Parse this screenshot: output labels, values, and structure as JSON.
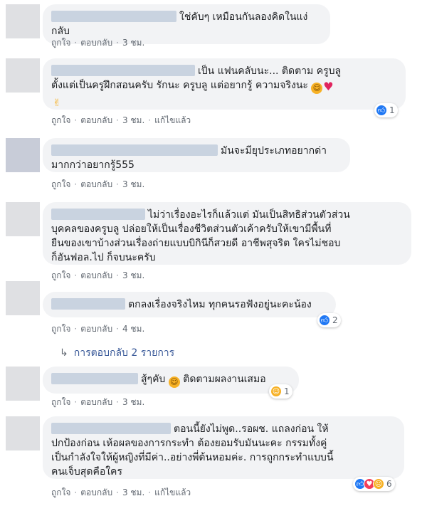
{
  "actions": {
    "like": "ถูกใจ",
    "reply": "ตอบกลับ",
    "edited": "แก้ไขแล้ว",
    "sep": "·"
  },
  "comments": [
    {
      "name": "",
      "text": "ใช่คับๆ เหมือนกันลองคิดในแง่กลับ",
      "time": "3 ชม."
    },
    {
      "name": "",
      "text1": "เป็น แฟนคลับนะ... ติดตาม ครูบลู",
      "text2": "ตั้งแต่เป็นครูฝึกสอนครับ รักนะ ครูบลู แต่อยากรู้ ความจริงนะ",
      "emoji": [
        "smile-emoji",
        "heart-emoji",
        "hand-emoji"
      ],
      "time": "3 ชม.",
      "edited": true,
      "reactions": {
        "count": "1",
        "icons": [
          "like"
        ]
      }
    },
    {
      "name": "",
      "text1": "มันจะมียุประเภทอยากด่า",
      "text2": "มากกว่าอยากรู้555",
      "time": "3 ชม."
    },
    {
      "name": "",
      "text1": "ไม่ว่าเรื่องอะไรก็แล้วแต่ มันเป็นสิทธิส่วนตัวส่วน",
      "text2": "บุคคลของครูบลู ปล่อยให้เป็นเรื่องชีวิตส่วนตัวเค้าครับให้เขามีพื้นที่",
      "text3": "ยืนของเขาบ้างส่วนเรื่องถ่ายแบบบิกินีก็สวยดี อาชีพสุจริต ใครไม่ชอบ",
      "text4": "ก็อันฟอล.ไป ก็จบนะครับ",
      "time": "3 ชม."
    },
    {
      "name": "",
      "text": "ตกลงเรื่องจริงไหม ทุกคนรอฟังอยู่นะคะน้อง",
      "time": "4 ชม.",
      "reactions": {
        "count": "2",
        "icons": [
          "like"
        ]
      }
    },
    {
      "name": "",
      "text": "สู้ๆคับ",
      "text_after": "ติดตามผลงานเสมอ",
      "time": "3 ชม.",
      "reactions": {
        "count": "1",
        "icons": [
          "haha"
        ]
      }
    },
    {
      "name": "",
      "text1": "ตอนนี้ยังไม่พูด..รอผช. แถลงก่อน ให้",
      "text2": "ปกป้องก่อน เห้อผลของการกระทำ ต้องยอมรับมันนะคะ กรรมทั้งคู่",
      "text3": "เป็นกำลังใจให้ผู้หญิงที่มีค่า..อย่างพี่ต้นหอมค่ะ. การถูกกระทำแบบนี้",
      "text4": "คนเจ็บสุดคือใคร",
      "time": "3 ชม.",
      "edited": true,
      "reactions": {
        "count": "6",
        "icons": [
          "like",
          "love",
          "sad"
        ]
      }
    }
  ],
  "replies_link": {
    "text": "การตอบกลับ 2 รายการ"
  }
}
